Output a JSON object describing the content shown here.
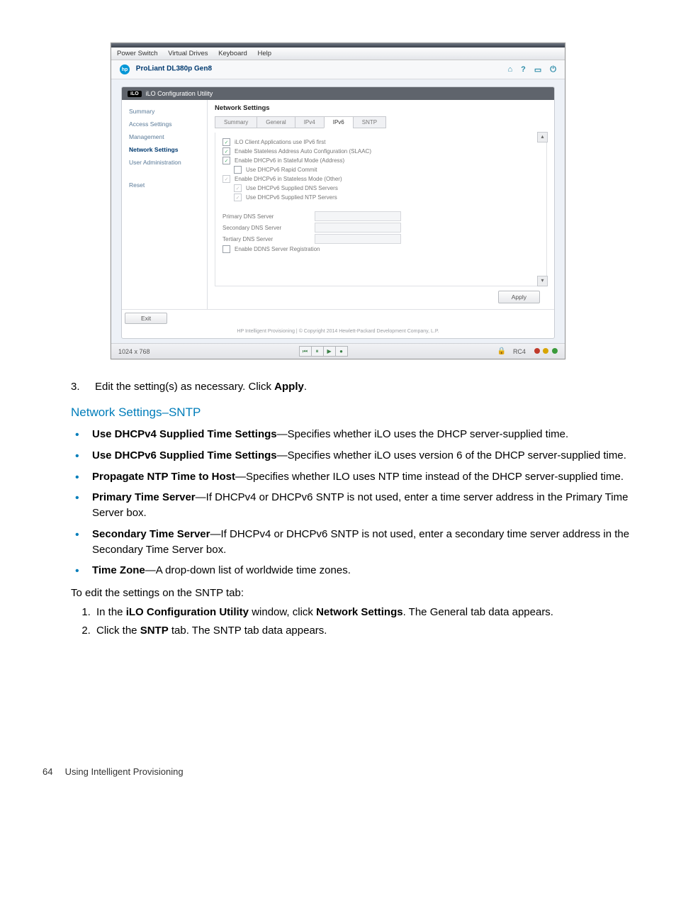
{
  "screenshot": {
    "menubar": [
      "Power Switch",
      "Virtual Drives",
      "Keyboard",
      "Help"
    ],
    "product": "ProLiant DL380p Gen8",
    "panel_title": "iLO Configuration Utility",
    "sidebar": {
      "items": [
        {
          "label": "Summary",
          "active": false
        },
        {
          "label": "Access Settings",
          "active": false
        },
        {
          "label": "Management",
          "active": false
        },
        {
          "label": "Network Settings",
          "active": true
        },
        {
          "label": "User Administration",
          "active": false
        },
        {
          "label": "Reset",
          "active": false
        }
      ]
    },
    "main": {
      "title": "Network Settings",
      "tabs": [
        "Summary",
        "General",
        "IPv4",
        "IPv6",
        "SNTP"
      ],
      "active_tab": "IPv6",
      "checkboxes": [
        {
          "label": "iLO Client Applications use IPv6 first",
          "checked": true,
          "indent": 0
        },
        {
          "label": "Enable Stateless Address Auto Configuration (SLAAC)",
          "checked": true,
          "indent": 0
        },
        {
          "label": "Enable DHCPv6 in Stateful Mode (Address)",
          "checked": true,
          "indent": 0
        },
        {
          "label": "Use DHCPv6 Rapid Commit",
          "checked": false,
          "indent": 1
        },
        {
          "label": "Enable DHCPv6 in Stateless Mode (Other)",
          "checked": true,
          "indent": 0,
          "disabled": true
        },
        {
          "label": "Use DHCPv6 Supplied DNS Servers",
          "checked": true,
          "indent": 1,
          "disabled": true
        },
        {
          "label": "Use DHCPv6 Supplied NTP Servers",
          "checked": true,
          "indent": 1,
          "disabled": true
        }
      ],
      "dns_rows": [
        "Primary DNS Server",
        "Secondary DNS Server",
        "Tertiary DNS Server"
      ],
      "ddns_label": "Enable DDNS Server Registration",
      "apply": "Apply",
      "exit": "Exit"
    },
    "footer_copy": "HP Intelligent Provisioning | © Copyright 2014 Hewlett-Packard Development Company, L.P.",
    "statusbar": {
      "resolution": "1024 x 768",
      "enc": "RC4"
    }
  },
  "doc": {
    "step3_num": "3.",
    "step3_a": "Edit the setting(s) as necessary. Click ",
    "step3_b": "Apply",
    "step3_c": ".",
    "heading": "Network Settings–SNTP",
    "bullets": [
      {
        "term": "Use DHCPv4 Supplied Time Settings",
        "rest": "—Specifies whether iLO uses the DHCP server-supplied time."
      },
      {
        "term": "Use DHCPv6 Supplied Time Settings",
        "rest": "—Specifies whether iLO uses version 6 of the DHCP server-supplied time."
      },
      {
        "term": "Propagate NTP Time to Host",
        "rest": "—Specifies whether ILO uses NTP time instead of the DHCP server-supplied time."
      },
      {
        "term": "Primary Time Server",
        "rest": "—If DHCPv4 or DHCPv6 SNTP is not used, enter a time server address in the Primary Time Server box."
      },
      {
        "term": "Secondary Time Server",
        "rest": "—If DHCPv4 or DHCPv6 SNTP is not used, enter a secondary time server address in the Secondary Time Server box."
      },
      {
        "term": "Time Zone",
        "rest": "—A drop-down list of worldwide time zones."
      }
    ],
    "procedure_intro": "To edit the settings on the SNTP tab:",
    "procedure": [
      {
        "pre": "In the ",
        "b1": "iLO Configuration Utility",
        "mid": " window, click ",
        "b2": "Network Settings",
        "post": ". The General tab data appears."
      },
      {
        "pre": "Click the ",
        "b1": "SNTP",
        "mid": "",
        "b2": "",
        "post": " tab. The SNTP tab data appears."
      }
    ],
    "footer": {
      "page": "64",
      "title": "Using Intelligent Provisioning"
    }
  }
}
